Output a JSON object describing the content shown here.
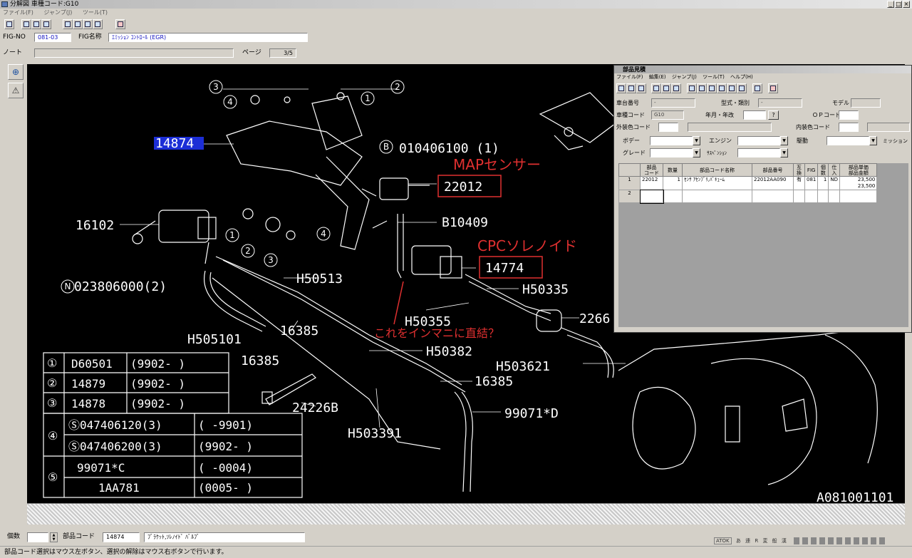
{
  "window": {
    "title": "分解図 車種コード:G10",
    "minimize": "_",
    "maximize": "□",
    "close": "×"
  },
  "menu": [
    "ファイル(F)",
    "ジャンプ(J)",
    "ツール(T)"
  ],
  "header": {
    "figno_label": "FIG-NO",
    "figno_value": "081-03",
    "figname_label": "FIG名称",
    "figname_value": "ｴﾐｯｼｮﾝ ｺﾝﾄﾛｰﾙ (EGR)",
    "note_label": "ノート",
    "page_label": "ページ",
    "page_value": "3/5"
  },
  "annotations": {
    "map_sensor": "MAPセンサー",
    "cpc_solenoid": "CPCソレノイド",
    "question": "これをインマニに直結？"
  },
  "callouts": {
    "c1": "14874",
    "c2": "010406100 (1)",
    "c3": "22012",
    "c4": "16102",
    "c5": "B10409",
    "c6": "14774",
    "c7": "023806000(2)",
    "c8": "H50513",
    "c9": "H50335",
    "c10": "H50355",
    "c11": "2266",
    "c12": "H505101",
    "c13": "16385",
    "c14": "16385",
    "c15": "H50382",
    "c16": "H503621",
    "c17": "16385",
    "c18": "24226B",
    "c19": "99071*D",
    "c20": "H503391",
    "c21": "A081001101"
  },
  "legend_rows": [
    {
      "num": "①",
      "part": "D60501",
      "range": "(9902-      )"
    },
    {
      "num": "②",
      "part": "14879",
      "range": "(9902-      )"
    },
    {
      "num": "③",
      "part": "14878",
      "range": "(9902-      )"
    }
  ],
  "legend4": [
    {
      "part": "Ⓢ047406120(3)",
      "range": "(      -9901)"
    },
    {
      "part": "Ⓢ047406200(3)",
      "range": "(9902-      )"
    }
  ],
  "legend5": [
    {
      "part": "99071*C",
      "range": "(      -0004)"
    },
    {
      "part": "1AA781",
      "range": "(0005-      )"
    }
  ],
  "popup": {
    "title": "部品見積",
    "menu": [
      "ファイル(F)",
      "編集(E)",
      "ジャンプ(J)",
      "ツール(T)",
      "ヘルプ(H)"
    ],
    "labels": {
      "chassis": "車台番号",
      "chassis_val": "-",
      "model_type": "型式・類別",
      "model_type_val": "-",
      "model": "モデル",
      "car_code": "車種コード",
      "car_code_val": "G10",
      "year": "年月・年改",
      "q": "?",
      "op_code": "ＯＰコード",
      "ext_color": "外装色コード",
      "int_color": "内装色コード",
      "body": "ボデー",
      "engine": "エンジン",
      "drive": "駆動",
      "mission": "ミッション",
      "grade": "グレード",
      "suspension": "ｻｽﾍﾟﾝｼｮﾝ"
    },
    "columns": [
      "",
      "部品\nコード",
      "数量",
      "部品コード名称",
      "部品番号",
      "互換",
      "FIG",
      "個数",
      "仕入",
      "部品単価\n部品金額"
    ],
    "rows": [
      {
        "n": "1",
        "code": "22012",
        "qty": "1",
        "name": "ｾﾝｻ ｱｾﾝﾌﾞﾘ,ﾊﾞｷｭｰﾑ",
        "pn": "22012AA090",
        "compat": "有",
        "fig": "081",
        "count": "1",
        "shiire": "ND",
        "price": "23,500",
        "amount": "23,500"
      },
      {
        "n": "2",
        "code": "",
        "qty": "",
        "name": "",
        "pn": "",
        "compat": "",
        "fig": "",
        "count": "",
        "shiire": "",
        "price": "",
        "amount": ""
      }
    ]
  },
  "bottom": {
    "qty_label": "個数",
    "partcode_label": "部品コード",
    "partcode_value": "14874",
    "partname_value": "ﾌﾞﾗｹｯﾄ,ｿﾚﾉｲﾄﾞ ﾊﾞﾙﾌﾞ",
    "atok": "ATOK",
    "ime": [
      "あ",
      "連",
      "R",
      "変",
      "般",
      "漢"
    ]
  },
  "status": "部品コード選択はマウス左ボタン、選択の解除はマウス右ボタンで行います。"
}
